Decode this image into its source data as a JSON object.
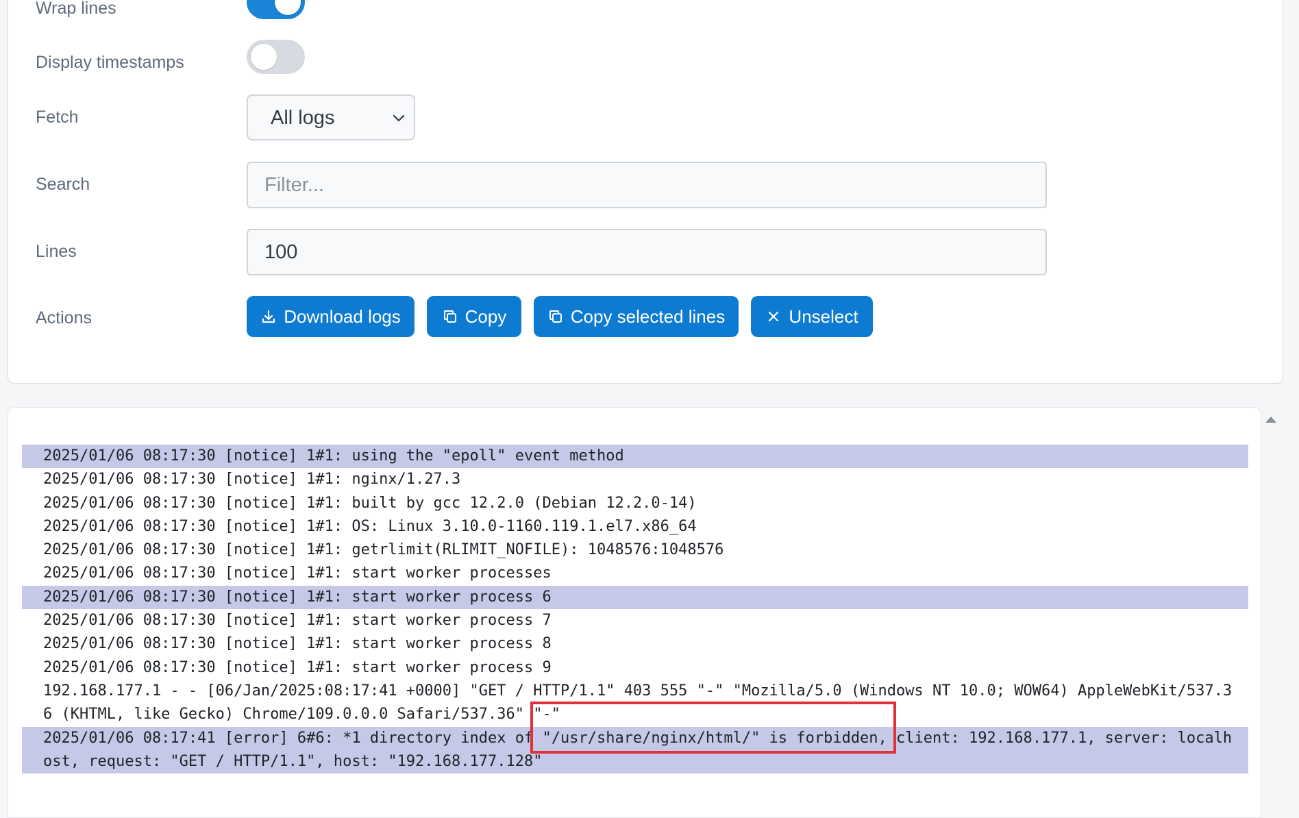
{
  "settings": {
    "wrap_lines": {
      "label": "Wrap lines",
      "on": true
    },
    "display_timestamps": {
      "label": "Display timestamps",
      "on": false
    },
    "fetch": {
      "label": "Fetch",
      "value": "All logs"
    },
    "search": {
      "label": "Search",
      "placeholder": "Filter...",
      "value": ""
    },
    "lines": {
      "label": "Lines",
      "value": "100"
    },
    "actions": {
      "label": "Actions",
      "download_label": "Download logs",
      "copy_label": "Copy",
      "copy_selected_label": "Copy selected lines",
      "unselect_label": "Unselect"
    }
  },
  "colors": {
    "primary": "#0e7bd3",
    "selected_line": "#c5c8e6",
    "highlight_box": "#e0303a"
  },
  "icons": {
    "download": "download-icon",
    "copy": "copy-icon",
    "unselect": "close-icon",
    "select_arrow": "chevron-down-icon"
  },
  "logs": [
    {
      "text": "2025/01/06 08:17:30 [notice] 1#1: using the \"epoll\" event method",
      "selected": true
    },
    {
      "text": "2025/01/06 08:17:30 [notice] 1#1: nginx/1.27.3",
      "selected": false
    },
    {
      "text": "2025/01/06 08:17:30 [notice] 1#1: built by gcc 12.2.0 (Debian 12.2.0-14)",
      "selected": false
    },
    {
      "text": "2025/01/06 08:17:30 [notice] 1#1: OS: Linux 3.10.0-1160.119.1.el7.x86_64",
      "selected": false
    },
    {
      "text": "2025/01/06 08:17:30 [notice] 1#1: getrlimit(RLIMIT_NOFILE): 1048576:1048576",
      "selected": false
    },
    {
      "text": "2025/01/06 08:17:30 [notice] 1#1: start worker processes",
      "selected": false
    },
    {
      "text": "2025/01/06 08:17:30 [notice] 1#1: start worker process 6",
      "selected": true
    },
    {
      "text": "2025/01/06 08:17:30 [notice] 1#1: start worker process 7",
      "selected": false
    },
    {
      "text": "2025/01/06 08:17:30 [notice] 1#1: start worker process 8",
      "selected": false
    },
    {
      "text": "2025/01/06 08:17:30 [notice] 1#1: start worker process 9",
      "selected": false
    },
    {
      "text": "192.168.177.1 - - [06/Jan/2025:08:17:41 +0000] \"GET / HTTP/1.1\" 403 555 \"-\" \"Mozilla/5.0 (Windows NT 10.0; WOW64) AppleWebKit/537.36 (KHTML, like Gecko) Chrome/109.0.0.0 Safari/537.36\" \"-\"",
      "selected": false
    },
    {
      "text": "2025/01/06 08:17:41 [error] 6#6: *1 directory index of \"/usr/share/nginx/html/\" is forbidden, client: 192.168.177.1, server: localhost, request: \"GET / HTTP/1.1\", host: \"192.168.177.128\"",
      "selected": true
    }
  ]
}
